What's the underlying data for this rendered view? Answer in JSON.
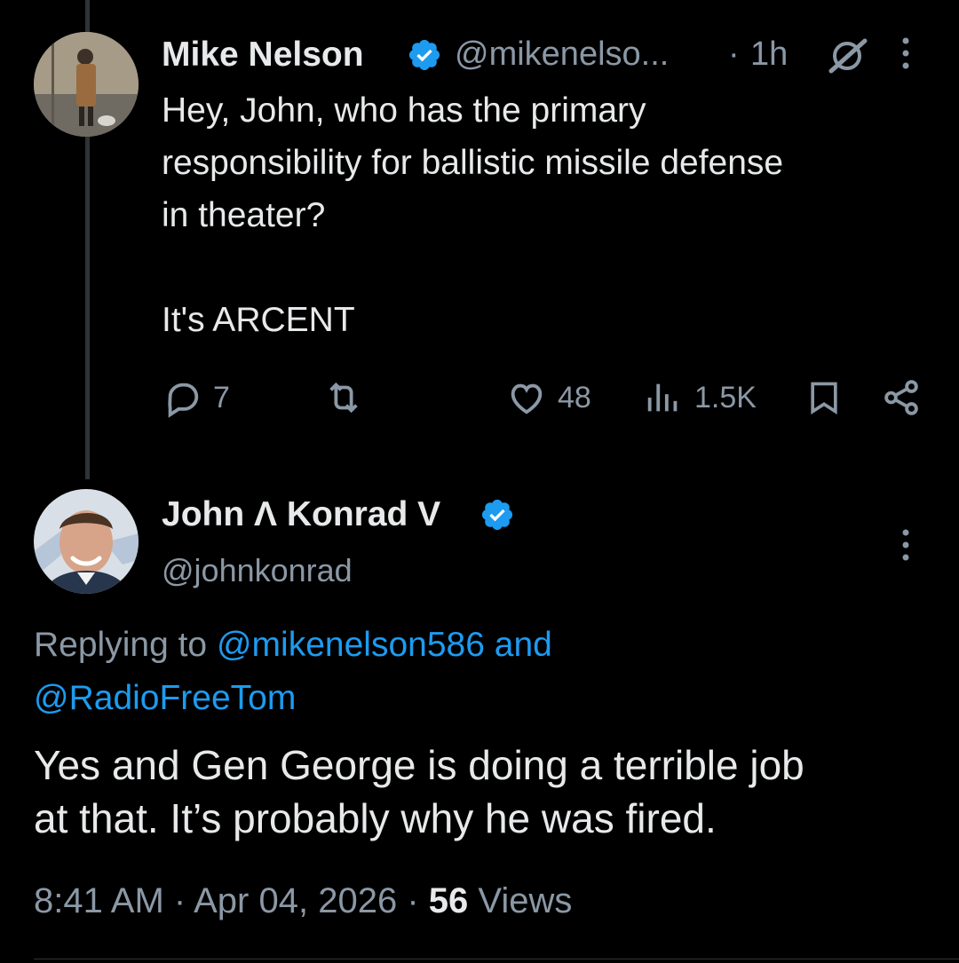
{
  "parent_tweet": {
    "author_name": "Mike Nelson",
    "handle": "@mikenelso...",
    "separator": "·",
    "time": "1h",
    "text_lines": [
      "Hey, John, who has the primary",
      "responsibility for ballistic missile defense",
      "in theater?",
      "",
      "It's ARCENT"
    ],
    "actions": {
      "replies": "7",
      "retweets": "",
      "likes": "48",
      "views": "1.5K"
    }
  },
  "main_tweet": {
    "author_name": "John Λ Konrad V",
    "handle": "@johnkonrad",
    "replying_prefix": "Replying to",
    "replying_user1": "@mikenelson586",
    "replying_and": "and",
    "replying_user2": "@RadioFreeTom",
    "text_line1": "Yes and Gen George is doing a terrible job",
    "text_line2": "at that. It’s probably why he was fired.",
    "time": "8:41 AM",
    "sep1": "·",
    "date": "Apr 04, 2026",
    "sep2": "·",
    "views_count": "56",
    "views_label": "Views"
  },
  "colors": {
    "background": "#000000",
    "text": "#e7e9ea",
    "muted": "#8b98a5",
    "link": "#1d9bf0",
    "verified": "#1d9bf0",
    "thread_line": "#2f3336"
  },
  "icons": [
    "verified-badge-icon",
    "grok-icon",
    "more-icon",
    "reply-icon",
    "retweet-icon",
    "like-icon",
    "views-icon",
    "bookmark-icon",
    "share-icon"
  ]
}
